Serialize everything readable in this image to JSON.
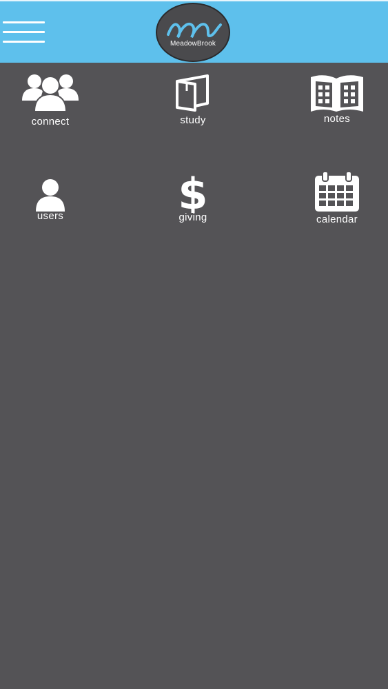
{
  "header": {
    "menu_icon": "hamburger-menu-icon",
    "logo_text": "MeadowBrook",
    "brand_color": "#5ec0ec",
    "logo_mark_color": "#5ec0ec"
  },
  "tiles": [
    {
      "label": "connect",
      "icon": "group-people-icon"
    },
    {
      "label": "study",
      "icon": "open-book-icon"
    },
    {
      "label": "notes",
      "icon": "notebook-icon"
    },
    {
      "label": "users",
      "icon": "user-icon"
    },
    {
      "label": "giving",
      "icon": "dollar-sign-icon"
    },
    {
      "label": "calendar",
      "icon": "calendar-icon"
    }
  ],
  "colors": {
    "background": "#545356",
    "icon": "#ffffff"
  }
}
